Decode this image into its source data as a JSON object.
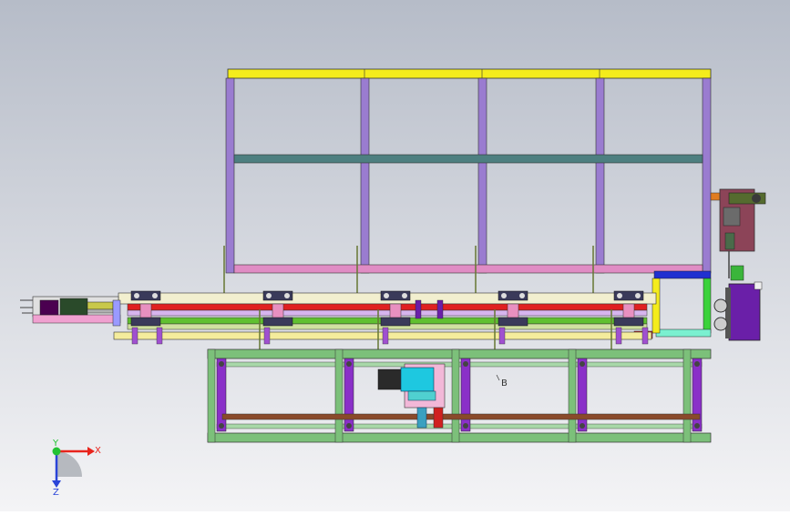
{
  "viewport": {
    "background_top": "#b6bcc8",
    "background_bottom": "#f4f4f6"
  },
  "annotation": {
    "label": "B"
  },
  "triad": {
    "x_label": "X",
    "y_label": "Y",
    "z_label": "Z",
    "x_color": "#e8241c",
    "y_color": "#22c232",
    "z_color": "#2a44d8"
  },
  "palette": {
    "yellow": "#f4ec1c",
    "purple": "#9a7cd0",
    "teal": "#4d7f80",
    "pink": "#e08cc4",
    "lilac": "#c8a0e0",
    "red": "#e02020",
    "green": "#3bb53b",
    "olive": "#8fb040",
    "frame_green": "#7cc07a",
    "dark_purple": "#6a1fa8",
    "brown": "#8a4a2a",
    "cyan": "#1ec8e0",
    "blue": "#2030d0",
    "maroon": "#8c4458",
    "cream": "#f2efcf",
    "gray": "#b8b8b8"
  }
}
